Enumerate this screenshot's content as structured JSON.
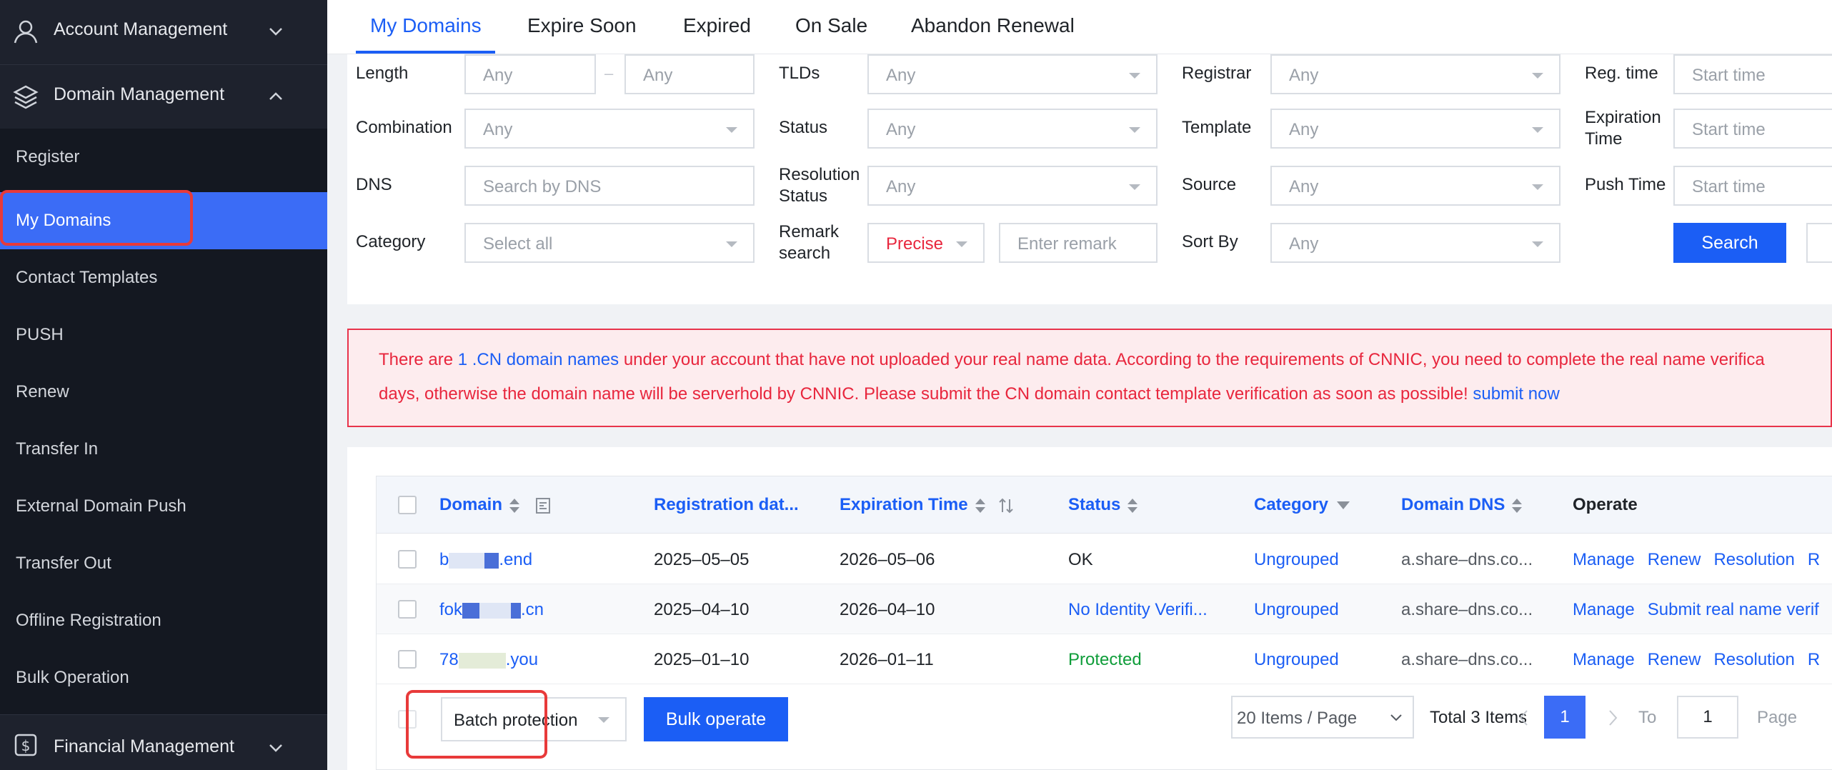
{
  "sidebar": {
    "groups": {
      "account": {
        "label": "Account Management",
        "icon": "user-icon",
        "chevron": "chevron-down-icon"
      },
      "domain": {
        "label": "Domain Management",
        "icon": "layers-icon",
        "chevron": "chevron-up-icon"
      },
      "financial": {
        "label": "Financial Management",
        "icon": "dollar-icon",
        "chevron": "chevron-down-icon"
      }
    },
    "items": [
      {
        "label": "Register"
      },
      {
        "label": "My Domains"
      },
      {
        "label": "Contact Templates"
      },
      {
        "label": "PUSH"
      },
      {
        "label": "Renew"
      },
      {
        "label": "Transfer In"
      },
      {
        "label": "External Domain Push"
      },
      {
        "label": "Transfer Out"
      },
      {
        "label": "Offline Registration"
      },
      {
        "label": "Bulk Operation"
      }
    ],
    "active_item": "My Domains"
  },
  "tabs": [
    "My Domains",
    "Expire Soon",
    "Expired",
    "On Sale",
    "Abandon Renewal"
  ],
  "filters": {
    "length": {
      "label": "Length",
      "min": "Any",
      "max": "Any",
      "sep": "–"
    },
    "tlds": {
      "label": "TLDs",
      "value": "Any"
    },
    "registrar": {
      "label": "Registrar",
      "value": "Any"
    },
    "reg_time": {
      "label": "Reg. time",
      "placeholder": "Start time"
    },
    "combination": {
      "label": "Combination",
      "value": "Any"
    },
    "status": {
      "label": "Status",
      "value": "Any"
    },
    "template": {
      "label": "Template",
      "value": "Any"
    },
    "expiration_time": {
      "label_line1": "Expiration",
      "label_line2": "Time",
      "placeholder": "Start time"
    },
    "dns": {
      "label": "DNS",
      "placeholder": "Search by DNS"
    },
    "resolution_status": {
      "label_line1": "Resolution",
      "label_line2": "Status",
      "value": "Any"
    },
    "source": {
      "label": "Source",
      "value": "Any"
    },
    "push_time": {
      "label": "Push Time",
      "placeholder": "Start time"
    },
    "category": {
      "label": "Category",
      "value": "Select all"
    },
    "remark": {
      "label_line1": "Remark",
      "label_line2": "search",
      "mode": "Precise",
      "placeholder": "Enter remark"
    },
    "sort_by": {
      "label": "Sort By",
      "value": "Any"
    },
    "search_button": "Search"
  },
  "alert": {
    "line1_pre": "There are ",
    "line1_link": "1 .CN domain names",
    "line1_post": " under your account that have not uploaded your real name data. According to the requirements of CNNIC, you need to complete the real name verifica",
    "line2_pre": "days, otherwise the domain name will be serverhold by CNNIC. Please submit the CN domain contact template verification as soon as possible! ",
    "line2_link": "submit now"
  },
  "table": {
    "columns": {
      "domain": "Domain",
      "registration": "Registration dat...",
      "expiration": "Expiration Time",
      "status": "Status",
      "category": "Category",
      "dns": "Domain DNS",
      "operate": "Operate"
    },
    "rows": [
      {
        "domain_a": "b",
        "domain_b": ".end",
        "registered": "2025–05–05",
        "expires": "2026–05–06",
        "status": "OK",
        "category": "Ungrouped",
        "dns": "a.share–dns.co...",
        "ops": [
          "Manage",
          "Renew",
          "Resolution",
          "R"
        ]
      },
      {
        "domain_a": "fok",
        "domain_b": ".cn",
        "registered": "2025–04–10",
        "expires": "2026–04–10",
        "status": "No Identity Verifi...",
        "category": "Ungrouped",
        "dns": "a.share–dns.co...",
        "ops": [
          "Manage",
          "Submit real name verif"
        ]
      },
      {
        "domain_a": "78",
        "domain_b": ".you",
        "registered": "2025–01–10",
        "expires": "2026–01–11",
        "status": "Protected",
        "category": "Ungrouped",
        "dns": "a.share–dns.co...",
        "ops": [
          "Manage",
          "Renew",
          "Resolution",
          "R"
        ]
      }
    ]
  },
  "footer": {
    "batch_select": "Batch protection",
    "bulk_button": "Bulk operate",
    "page_size": "20 Items / Page",
    "total": "Total 3 Items",
    "current_page": "1",
    "goto_label": "To",
    "goto_value": "1",
    "page_suffix": "Page"
  },
  "colors": {
    "accent": "#1b5ef5",
    "sidebar_bg": "#1e222d",
    "alert_red": "#e8263d",
    "ok_green": "#0f9d3a",
    "highlight_red": "#e83a3a"
  }
}
